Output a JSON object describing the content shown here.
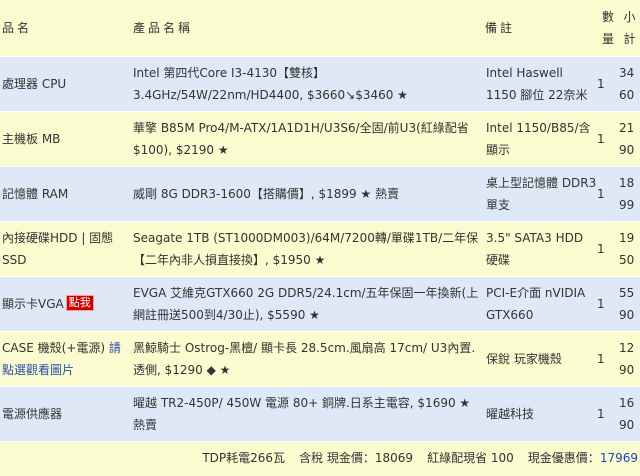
{
  "header": {
    "category": "品名",
    "product": "產品名稱",
    "note": "備註",
    "qty_top": "數",
    "qty_bottom": "量",
    "sub_top": "小",
    "sub_bottom": "計"
  },
  "rows": [
    {
      "category": "處理器 CPU",
      "product": "Intel 第四代Core I3-4130【雙核】3.4GHz/54W/22nm/HD4400, $3660↘$3460 ★",
      "note": "Intel Haswell 1150 腳位 22奈米",
      "qty": "1",
      "sub_top": "34",
      "sub_bottom": "60"
    },
    {
      "category": "主機板 MB",
      "product": "華擎 B85M Pro4/M-ATX/1A1D1H/U3S6/全固/前U3(紅綠配省$100), $2190 ★",
      "note": "Intel 1150/B85/含顯示",
      "qty": "1",
      "sub_top": "21",
      "sub_bottom": "90"
    },
    {
      "category": "記憶體 RAM",
      "product": "威剛 8G DDR3-1600【搭購價】, $1899 ★ 熱賣",
      "note": "桌上型記憶體 DDR3 單支",
      "qty": "1",
      "sub_top": "18",
      "sub_bottom": "99"
    },
    {
      "category": "內接硬碟HDD | 固態SSD",
      "product": "Seagate 1TB (ST1000DM003)/64M/7200轉/單碟1TB/二年保【二年內非人損直接換】, $1950 ★",
      "note": "3.5\" SATA3 HDD 硬碟",
      "qty": "1",
      "sub_top": "19",
      "sub_bottom": "50"
    },
    {
      "category": "顯示卡VGA",
      "hot": "點我",
      "product": "EVGA 艾維克GTX660 2G DDR5/24.1cm/五年保固一年換新(上網註冊送500到4/30止), $5590 ★",
      "note": "PCI-E介面 nVIDIA GTX660",
      "qty": "1",
      "sub_top": "55",
      "sub_bottom": "90"
    },
    {
      "category": "CASE 機殼(+電源)",
      "category_link": "請點選觀看圖片",
      "product": "黑鯨騎士 Ostrog-黑檀/ 顯卡長 28.5cm.風扇高 17cm/ U3內置.透側, $1290 ◆ ★",
      "note": "保銳 玩家機殼",
      "qty": "1",
      "sub_top": "12",
      "sub_bottom": "90"
    },
    {
      "category": "電源供應器",
      "product": "曜越 TR2-450P/ 450W 電源 80+ 銅牌.日系主電容, $1690 ★ 熱賣",
      "note": "曜越科技",
      "qty": "1",
      "sub_top": "16",
      "sub_bottom": "90"
    }
  ],
  "footer": {
    "tdp": "TDP耗電266瓦",
    "tax_cash_label": "含稅 現金價：18069",
    "combo_label": "紅綠配現省 100",
    "promo_label": "現金優惠價：",
    "promo_value": "17969"
  },
  "colors": {
    "row_blue": "#dfe8f6",
    "row_yellow": "#fbfbd0",
    "hot_badge": "#cc0000",
    "link_blue": "#2a4fa8"
  }
}
